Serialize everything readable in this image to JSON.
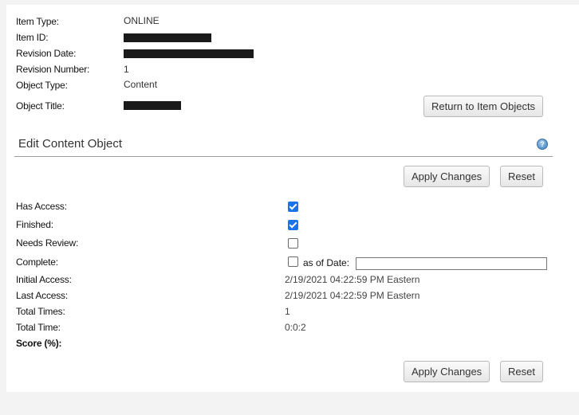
{
  "header": {
    "item_type_label": "Item Type:",
    "item_type_value": "ONLINE",
    "item_id_label": "Item ID:",
    "revision_date_label": "Revision Date:",
    "revision_number_label": "Revision Number:",
    "revision_number_value": "1",
    "object_type_label": "Object Type:",
    "object_type_value": "Content",
    "object_title_label": "Object Title:",
    "return_button": "Return to Item Objects"
  },
  "section": {
    "title": "Edit Content Object",
    "help_icon": "question-circle-icon"
  },
  "toolbar": {
    "apply_label": "Apply Changes",
    "reset_label": "Reset"
  },
  "fields": {
    "has_access_label": "Has Access:",
    "has_access_checked": true,
    "finished_label": "Finished:",
    "finished_checked": true,
    "needs_review_label": "Needs Review:",
    "needs_review_checked": false,
    "complete_label": "Complete:",
    "complete_checked": false,
    "as_of_date_label": "as of Date:",
    "as_of_date_value": "",
    "initial_access_label": "Initial Access:",
    "initial_access_value": "2/19/2021 04:22:59 PM Eastern",
    "last_access_label": "Last Access:",
    "last_access_value": "2/19/2021 04:22:59 PM Eastern",
    "total_times_label": "Total Times:",
    "total_times_value": "1",
    "total_time_label": "Total Time:",
    "total_time_value": "0:0:2",
    "score_label": "Score (%):",
    "score_value": ""
  },
  "colors": {
    "checkbox_checked": "#1a73e8",
    "redaction": "#1a1a1a"
  }
}
